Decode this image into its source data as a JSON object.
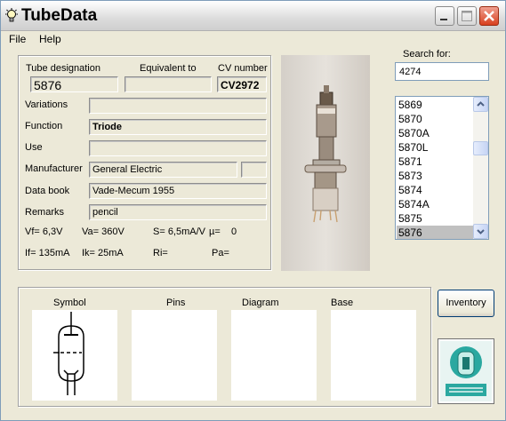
{
  "window": {
    "title": "TubeData"
  },
  "menu": {
    "file": "File",
    "help": "Help"
  },
  "fields": {
    "tube_designation_label": "Tube designation",
    "tube_designation": "5876",
    "equivalent_label": "Equivalent to",
    "equivalent": "",
    "cv_label": "CV number",
    "cv": "CV2972",
    "variations_label": "Variations",
    "variations": "",
    "function_label": "Function",
    "function": "Triode",
    "use_label": "Use",
    "use": "",
    "manufacturer_label": "Manufacturer",
    "manufacturer": "General Electric",
    "manufacturer_extra": "",
    "databook_label": "Data book",
    "databook": "Vade-Mecum 1955",
    "remarks_label": "Remarks",
    "remarks": "pencil"
  },
  "params": {
    "vf": "Vf= 6,3V",
    "va": "Va= 360V",
    "s": "S= 6,5mA/V",
    "mu": "µ=",
    "mu_val": "0",
    "if": "If= 135mA",
    "ik": "Ik= 25mA",
    "ri": "Ri=",
    "pa": "Pa="
  },
  "search": {
    "label": "Search for:",
    "value": "4274"
  },
  "list": {
    "items": [
      "5869",
      "5870",
      "5870A",
      "5870L",
      "5871",
      "5873",
      "5874",
      "5874A",
      "5875",
      "5876"
    ],
    "selected_index": 9
  },
  "panels": {
    "symbol": "Symbol",
    "pins": "Pins",
    "diagram": "Diagram",
    "base": "Base"
  },
  "buttons": {
    "inventory": "Inventory"
  },
  "icons": {
    "app": "lightbulb-icon",
    "minimize": "minimize-icon",
    "maximize": "maximize-icon",
    "close": "close-icon",
    "scroll_up": "chevron-up-icon",
    "scroll_down": "chevron-down-icon"
  },
  "colors": {
    "close_button": "#d8401f",
    "list_selection": "#c0c0c0",
    "logo_teal": "#2aa8a0"
  }
}
